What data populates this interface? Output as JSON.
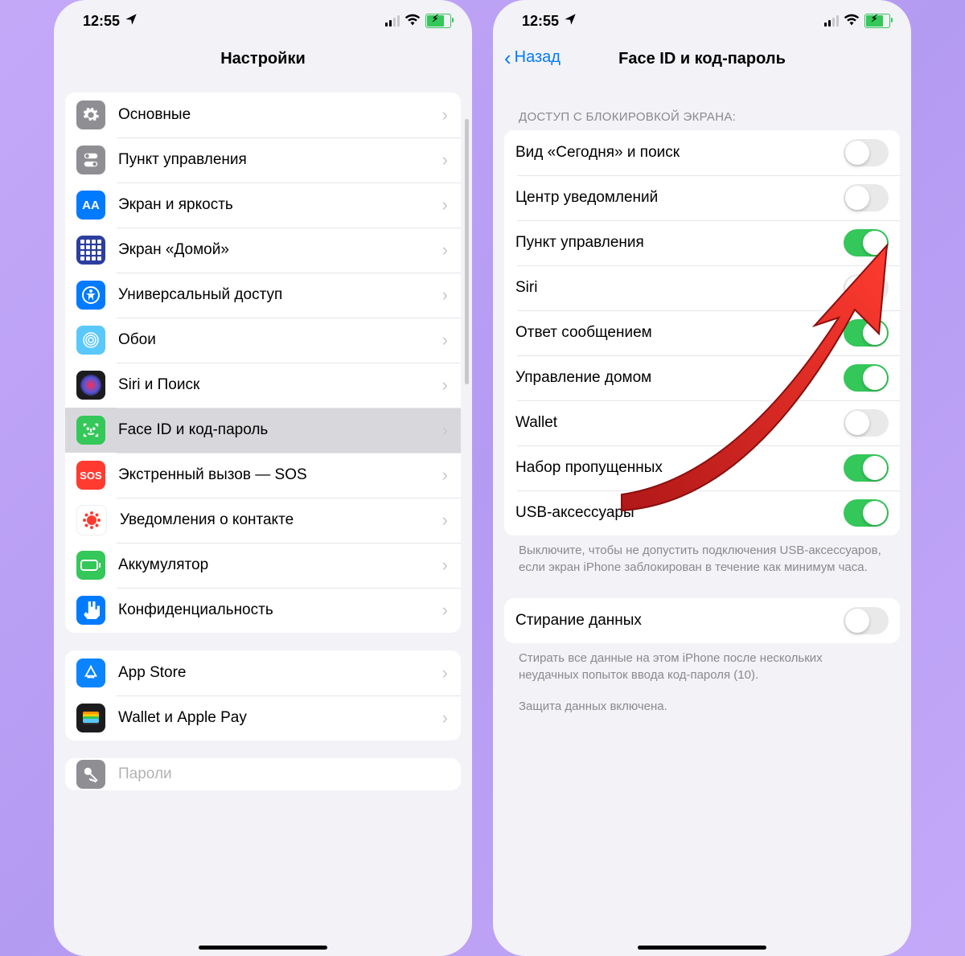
{
  "status": {
    "time": "12:55"
  },
  "left": {
    "header_title": "Настройки",
    "group1": [
      {
        "label": "Основные"
      },
      {
        "label": "Пункт управления"
      },
      {
        "label": "Экран и яркость"
      },
      {
        "label": "Экран «Домой»"
      },
      {
        "label": "Универсальный доступ"
      },
      {
        "label": "Обои"
      },
      {
        "label": "Siri и Поиск"
      },
      {
        "label": "Face ID и код-пароль"
      },
      {
        "label": "Экстренный вызов — SOS"
      },
      {
        "label": "Уведомления о контакте"
      },
      {
        "label": "Аккумулятор"
      },
      {
        "label": "Конфиденциальность"
      }
    ],
    "group2": [
      {
        "label": "App Store"
      },
      {
        "label": "Wallet и Apple Pay"
      }
    ],
    "group3_peek": "Пароли"
  },
  "right": {
    "back_label": "Назад",
    "header_title": "Face ID и код-пароль",
    "section_header": "Доступ с блокировкой экрана:",
    "toggles": [
      {
        "label": "Вид «Сегодня» и поиск",
        "on": false
      },
      {
        "label": "Центр уведомлений",
        "on": false
      },
      {
        "label": "Пункт управления",
        "on": true
      },
      {
        "label": "Siri",
        "on": false
      },
      {
        "label": "Ответ сообщением",
        "on": true
      },
      {
        "label": "Управление домом",
        "on": true
      },
      {
        "label": "Wallet",
        "on": false
      },
      {
        "label": "Набор пропущенных",
        "on": true
      },
      {
        "label": "USB-аксессуары",
        "on": true
      }
    ],
    "usb_note": "Выключите, чтобы не допустить подключения USB-аксессуаров, если экран iPhone заблокирован в течение как минимум часа.",
    "erase": {
      "label": "Стирание данных",
      "on": false
    },
    "erase_note": "Стирать все данные на этом iPhone после нескольких неудачных попыток ввода код-пароля (10).",
    "protection_note": "Защита данных включена."
  }
}
